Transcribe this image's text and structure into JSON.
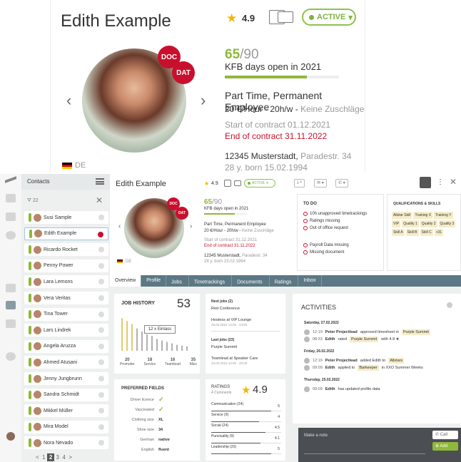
{
  "zoom": {
    "name": "Edith Example",
    "rating": "4.9",
    "status": "ACTIVE",
    "doc": "DOC",
    "dat": "DAT",
    "country": "DE",
    "kfb_days": "65",
    "kfb_total": "/90",
    "kfb_label": "KFB days open in 2021",
    "kfb_progress": 0.72,
    "employment": "Part Time, Permanent Employee",
    "rate": "20 €/Hour - 20h/w - ",
    "rate_extra": "Keine Zuschläge",
    "start_label": "Start of contract ",
    "start_date": "01.12.2021",
    "end_label": "End of contract 31.11.2022",
    "address": "12345 Musterstadt, ",
    "street": "Paradestr. 34",
    "born": "28 y. born 15.02.1994"
  },
  "sidebar": {
    "title": "Contacts",
    "filter": "22",
    "contacts": [
      "Susi Sample",
      "Edith Example",
      "Ricardo Rocket",
      "Penny Power",
      "Lara Lemons",
      "Vera Veritas",
      "Tina Tower",
      "Lars Lindrek",
      "Angela Aruzza",
      "Ahmed Atusani",
      "Jenny Jungbrunn",
      "Sandra Schmidt",
      "Mikkel Müller",
      "Mira Model",
      "Nora Nevado"
    ],
    "pager": [
      "<",
      "1",
      "2",
      "3",
      "4",
      ">"
    ]
  },
  "header": {
    "name": "Edith Example",
    "rating": "4.9",
    "status": "ACTIVE",
    "start_label": "Start of contract 31.12.2021",
    "end_label": "End of contract 31.11.2022",
    "address": "12345 Musterstadt, ",
    "street": "Paradestr. 34",
    "born": "28 y. born 15.02.1994"
  },
  "todo": {
    "title": "TO DO",
    "items": [
      "10h unapproved timetrackings",
      "Ratings missing",
      "Out of office request",
      "Payroll Data missing",
      "Missing document"
    ]
  },
  "quals": {
    "title": "QUALIFICATIONS & SKILLS",
    "tags": [
      "Allstar Skill",
      "Training X",
      "Training Y",
      "VIP",
      "Quality 1",
      "Quality 2",
      "Quality 3",
      "Skill A",
      "Skill B",
      "Skill C",
      "+31"
    ]
  },
  "tabs": [
    "Overview",
    "Profile",
    "Jobs",
    "Timetrackings",
    "Documents",
    "Ratings",
    "Inbox"
  ],
  "job_history": {
    "title": "JOB HISTORY",
    "count": "53",
    "tooltip": "12 x Einlass",
    "legend": [
      {
        "n": "20",
        "l": "Promoter"
      },
      {
        "n": "18",
        "l": "Service"
      },
      {
        "n": "16",
        "l": "Teamlead"
      },
      {
        "n": "35",
        "l": "Misc"
      }
    ]
  },
  "chart_data": {
    "type": "bar",
    "values": [
      44,
      40,
      36,
      30,
      26,
      22,
      20,
      16,
      14,
      12,
      10,
      8,
      7,
      6
    ],
    "ylim": [
      0,
      48
    ]
  },
  "next_jobs": {
    "h1": "Next jobs (2)",
    "j1": "Red Conference",
    "j2": "Hostess at VIP Lounge",
    "d2": "28.02.2022  13:00 - 24:00",
    "h2": "Last jobs (23)",
    "j3": "Purple Summit",
    "j4": "Teamlead at Speaker Care",
    "d4": "23.02.2022  13:00 - 20:00"
  },
  "pref": {
    "title": "PREFERRED FIELDS",
    "rows": [
      [
        "Driver licence",
        "✓"
      ],
      [
        "Vaccinated",
        "✓"
      ],
      [
        "Clothing size",
        "XL"
      ],
      [
        "Shoe size",
        "34"
      ],
      [
        "German",
        "native"
      ],
      [
        "English",
        "fluent"
      ]
    ]
  },
  "ratings": {
    "title": "RATINGS",
    "comments": "4 Comments",
    "value": "4.9",
    "rows": [
      [
        "Communication (24)",
        "5"
      ],
      [
        "Service (9)",
        "4"
      ],
      [
        "Social (24)",
        "4.5"
      ],
      [
        "Punctuality (9)",
        "4.1"
      ],
      [
        "Leadership (20)",
        "5"
      ]
    ]
  },
  "activities": {
    "title": "ACTIVITIES",
    "groups": [
      {
        "date": "Saturday, 27.02.2022",
        "items": [
          [
            "12:19",
            "Peter Projectlead",
            "approved timesheet in",
            "Purple Summit"
          ],
          [
            "08:33",
            "Edith",
            "rated",
            "Purple Summit",
            "with 4.9 ★"
          ]
        ]
      },
      {
        "date": "Friday, 26.02.2022",
        "items": [
          [
            "12:19",
            "Peter Projectlead",
            "added Edith to",
            "Allstars"
          ],
          [
            "09:09",
            "Edith",
            "applied to",
            "Barkeeper",
            "in  XXO Summer Weeks"
          ]
        ]
      },
      {
        "date": "Thursday, 25.02.2022",
        "items": [
          [
            "09:09",
            "Edith",
            "has updated profile data",
            "",
            ""
          ]
        ]
      }
    ]
  },
  "note": {
    "placeholder": "Make a note",
    "call": "Call",
    "add": "Add"
  }
}
